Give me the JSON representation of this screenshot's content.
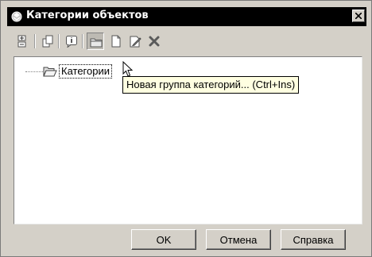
{
  "window": {
    "title": "Категории объектов"
  },
  "toolbar": {
    "buttons": [
      {
        "icon": "expand-collapse-icon"
      },
      {
        "icon": "copy-icon"
      },
      {
        "icon": "properties-icon"
      },
      {
        "icon": "new-group-icon",
        "pressed": true
      },
      {
        "icon": "new-item-icon"
      },
      {
        "icon": "edit-icon"
      },
      {
        "icon": "delete-icon"
      }
    ]
  },
  "tree": {
    "root_label": "Категории"
  },
  "tooltip": {
    "text": "Новая группа категорий... (Ctrl+Ins)"
  },
  "buttons": {
    "ok": "OK",
    "cancel": "Отмена",
    "help": "Справка"
  },
  "colors": {
    "titlebar": "#000000",
    "window": "#d4d0c8",
    "tooltip": "#ffffe1",
    "delete_icon": "#5a5a5a"
  }
}
